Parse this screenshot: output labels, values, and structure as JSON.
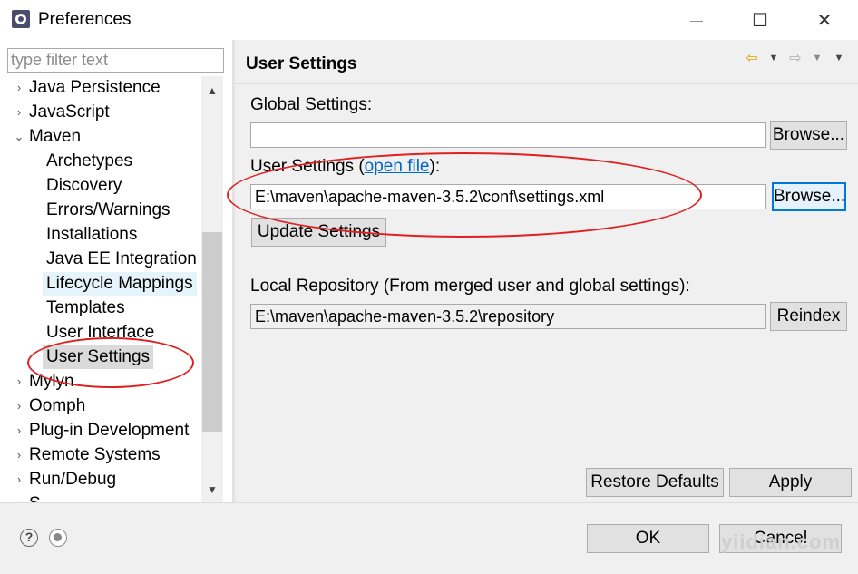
{
  "window": {
    "title": "Preferences",
    "icon": "eclipse-gear-icon",
    "minimize_glyph": "—",
    "maximize_glyph": "☐",
    "close_glyph": "✕"
  },
  "filter": {
    "placeholder": "type filter text",
    "value": ""
  },
  "tree": {
    "items": [
      {
        "label": "Java Persistence",
        "expander": "›"
      },
      {
        "label": "JavaScript",
        "expander": "›"
      },
      {
        "label": "Maven",
        "expander": "⌄"
      },
      {
        "label": "Archetypes"
      },
      {
        "label": "Discovery"
      },
      {
        "label": "Errors/Warnings"
      },
      {
        "label": "Installations"
      },
      {
        "label": "Java EE Integration"
      },
      {
        "label": "Lifecycle Mappings"
      },
      {
        "label": "Templates"
      },
      {
        "label": "User Interface"
      },
      {
        "label": "User Settings"
      },
      {
        "label": "Mylyn",
        "expander": "›"
      },
      {
        "label": "Oomph",
        "expander": "›"
      },
      {
        "label": "Plug-in Development",
        "expander": "›"
      },
      {
        "label": "Remote Systems",
        "expander": "›"
      },
      {
        "label": "Run/Debug",
        "expander": "›"
      },
      {
        "label": "S",
        "expander": "›"
      }
    ],
    "selected": "User Settings",
    "scroll_up_glyph": "▲",
    "scroll_down_glyph": "▼"
  },
  "page": {
    "title": "User Settings",
    "nav": {
      "back_glyph": "⇦",
      "back_menu_glyph": "▼",
      "forward_glyph": "⇨",
      "forward_menu_glyph": "▼",
      "view_menu_glyph": "▼"
    },
    "global_settings": {
      "label": "Global Settings:",
      "value": "",
      "browse_label": "Browse..."
    },
    "user_settings": {
      "label_prefix": "User Settings (",
      "link_text": "open file",
      "label_suffix": "):",
      "value": "E:\\maven\\apache-maven-3.5.2\\conf\\settings.xml",
      "browse_label": "Browse..."
    },
    "update_settings_label": "Update Settings",
    "local_repository": {
      "label": "Local Repository (From merged user and global settings):",
      "value": "E:\\maven\\apache-maven-3.5.2\\repository",
      "reindex_label": "Reindex"
    },
    "restore_defaults_label": "Restore Defaults",
    "apply_label": "Apply"
  },
  "footer": {
    "help_glyph": "?",
    "ok_label": "OK",
    "cancel_label": "Cancel",
    "watermark": "yiidian.com"
  },
  "colors": {
    "annotation": "#e02020",
    "selection": "#dadada",
    "hover": "#e5f3fb",
    "focus_border": "#0078d7",
    "link": "#0066cc"
  }
}
